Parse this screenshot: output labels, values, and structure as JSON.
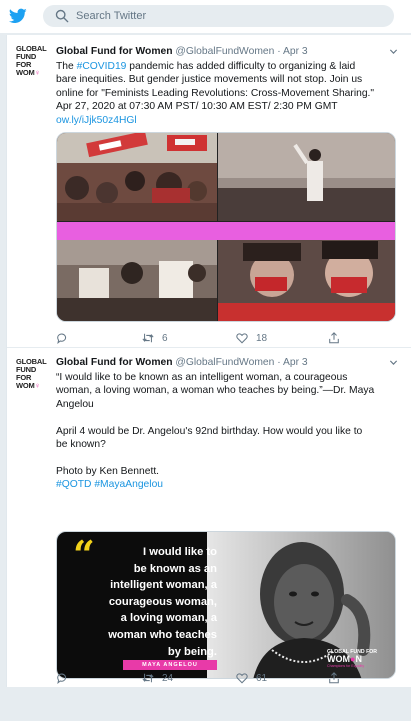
{
  "search": {
    "placeholder": "Search Twitter"
  },
  "colors": {
    "brand": "#1da1f2",
    "link": "#1b95e0",
    "muted": "#657786",
    "accent_pink": "#e83aa8"
  },
  "avatar_logo": {
    "line1": "GLOBAL",
    "line2": "FUND",
    "line3": "FOR",
    "line4": "WOM",
    "line4_mark": "♀"
  },
  "tweets": [
    {
      "name": "Global Fund for Women",
      "handle": "@GlobalFundWomen",
      "date": "Apr 3",
      "lines": [
        {
          "pre": "The ",
          "link": "#COVID19",
          "post": " pandemic has added difficulty to organizing & laid"
        },
        {
          "text": "bare inequities. But gender justice movements will not stop. Join us"
        },
        {
          "text": "online for \"Feminists Leading Revolutions: Cross-Movement Sharing.\""
        },
        {
          "text": "Apr 27, 2020 at 07:30 AM PST/ 10:30 AM EST/ 2:30 PM GMT"
        },
        {
          "link": "ow.ly/iJjk50z4HGl"
        }
      ],
      "replies": "",
      "retweets": "6",
      "likes": "18"
    },
    {
      "name": "Global Fund for Women",
      "handle": "@GlobalFundWomen",
      "date": "Apr 3",
      "lines": [
        {
          "text": "“I would like to be known as an intelligent woman, a courageous"
        },
        {
          "text": "woman, a loving woman, a woman who teaches by being.”—Dr. Maya"
        },
        {
          "text": "Angelou"
        },
        {
          "text": "April 4 would be Dr. Angelou's 92nd birthday. How would you like to"
        },
        {
          "text": "be known?"
        },
        {
          "text": "Photo by Ken Bennett."
        },
        {
          "link": "#QOTD #MayaAngelou"
        }
      ],
      "quote_card": {
        "quote": "I would like to be known as an intelligent woman, a courageous woman, a loving woman, a woman who teaches by being.",
        "quote_lines": [
          "I would like to",
          "be known as an",
          "intelligent woman, a",
          "courageous woman,",
          "a loving woman, a",
          "woman who teaches",
          "by being."
        ],
        "author": "MAYA ANGELOU",
        "logo_line1": "GLOBAL FUND FOR",
        "logo_line2_a": "WOM",
        "logo_line2_b": "N",
        "logo_tag": "Champions for Equality"
      },
      "replies": "",
      "retweets": "24",
      "likes": "61"
    }
  ]
}
